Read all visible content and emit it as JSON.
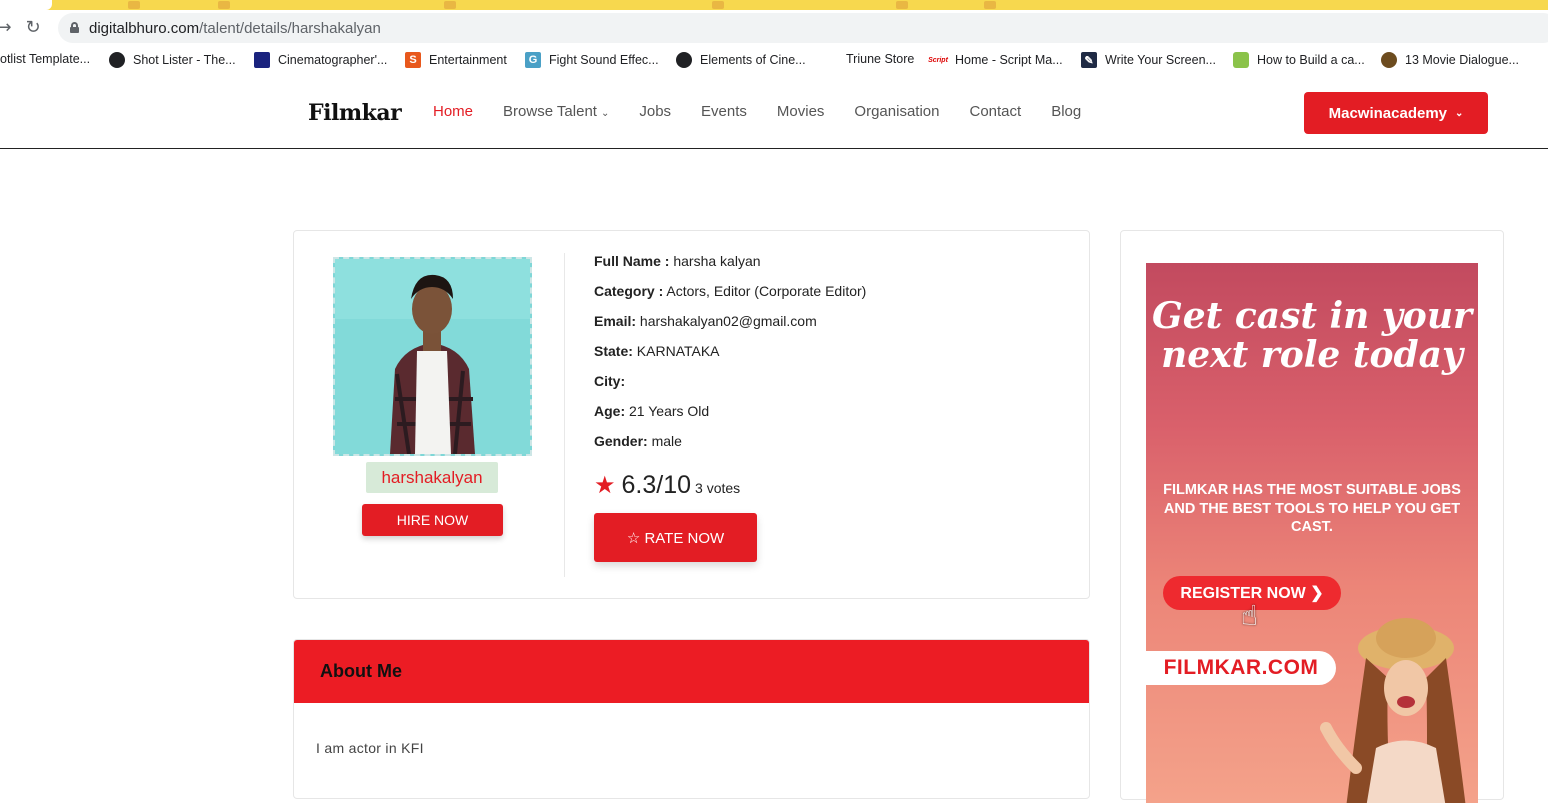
{
  "browser": {
    "url_domain": "digitalbhuro.com",
    "url_path": "/talent/details/harshakalyan",
    "bookmarks": [
      {
        "label": "otlist Template...",
        "icon": "none"
      },
      {
        "label": "Shot Lister - The...",
        "icon": "globe-icon"
      },
      {
        "label": "Cinematographer'...",
        "icon": "film-icon"
      },
      {
        "label": "Entertainment",
        "icon": "s-icon"
      },
      {
        "label": "Fight Sound Effec...",
        "icon": "g-icon"
      },
      {
        "label": "Elements of Cine...",
        "icon": "globe-icon"
      },
      {
        "label": "Triune Store",
        "icon": "none"
      },
      {
        "label": "Home - Script Ma...",
        "icon": "script-icon"
      },
      {
        "label": "Write Your Screen...",
        "icon": "pen-icon"
      },
      {
        "label": "How to Build a ca...",
        "icon": "hex-icon"
      },
      {
        "label": "13 Movie Dialogue...",
        "icon": "movie-icon"
      }
    ]
  },
  "header": {
    "logo": "Filmkar",
    "nav": [
      {
        "label": "Home",
        "active": true
      },
      {
        "label": "Browse Talent",
        "dropdown": true
      },
      {
        "label": "Jobs"
      },
      {
        "label": "Events"
      },
      {
        "label": "Movies"
      },
      {
        "label": "Organisation"
      },
      {
        "label": "Contact"
      },
      {
        "label": "Blog"
      }
    ],
    "account_label": "Macwinacademy",
    "accent_color": "#e31d24"
  },
  "profile": {
    "username": "harshakalyan",
    "hire_label": "HIRE NOW",
    "fields": [
      {
        "label": "Full Name :",
        "value": "harsha kalyan"
      },
      {
        "label": "Category :",
        "value": "Actors, Editor (Corporate Editor)"
      },
      {
        "label": "Email:",
        "value": "harshakalyan02@gmail.com"
      },
      {
        "label": "State:",
        "value": "KARNATAKA"
      },
      {
        "label": "City:",
        "value": ""
      },
      {
        "label": "Age:",
        "value": "21 Years Old"
      },
      {
        "label": "Gender:",
        "value": "male"
      }
    ],
    "rating": "6.3/10",
    "votes": "3 votes",
    "rate_label": "☆ RATE NOW"
  },
  "about": {
    "title": "About Me",
    "text": "I am actor in KFI"
  },
  "ad": {
    "headline": "Get cast in your next role today",
    "subtext": "FILMKAR HAS THE MOST SUITABLE JOBS AND THE BEST TOOLS  TO HELP YOU GET CAST.",
    "register_label": "REGISTER  NOW ❯",
    "site": "FILMKAR.COM"
  }
}
